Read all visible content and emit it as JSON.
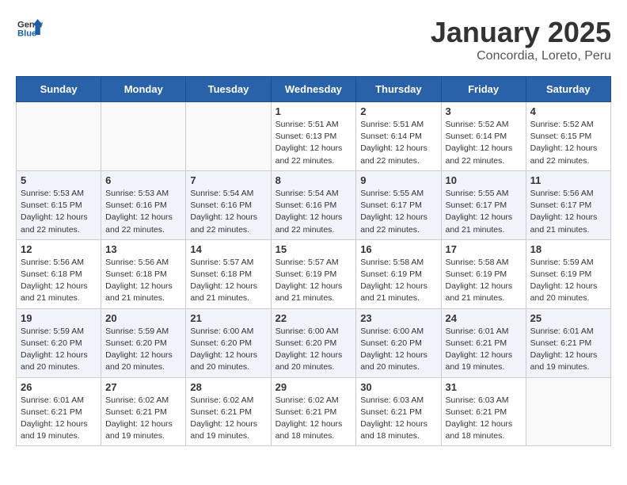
{
  "header": {
    "logo_general": "General",
    "logo_blue": "Blue",
    "month": "January 2025",
    "location": "Concordia, Loreto, Peru"
  },
  "weekdays": [
    "Sunday",
    "Monday",
    "Tuesday",
    "Wednesday",
    "Thursday",
    "Friday",
    "Saturday"
  ],
  "weeks": [
    [
      {
        "day": "",
        "info": ""
      },
      {
        "day": "",
        "info": ""
      },
      {
        "day": "",
        "info": ""
      },
      {
        "day": "1",
        "info": "Sunrise: 5:51 AM\nSunset: 6:13 PM\nDaylight: 12 hours\nand 22 minutes."
      },
      {
        "day": "2",
        "info": "Sunrise: 5:51 AM\nSunset: 6:14 PM\nDaylight: 12 hours\nand 22 minutes."
      },
      {
        "day": "3",
        "info": "Sunrise: 5:52 AM\nSunset: 6:14 PM\nDaylight: 12 hours\nand 22 minutes."
      },
      {
        "day": "4",
        "info": "Sunrise: 5:52 AM\nSunset: 6:15 PM\nDaylight: 12 hours\nand 22 minutes."
      }
    ],
    [
      {
        "day": "5",
        "info": "Sunrise: 5:53 AM\nSunset: 6:15 PM\nDaylight: 12 hours\nand 22 minutes."
      },
      {
        "day": "6",
        "info": "Sunrise: 5:53 AM\nSunset: 6:16 PM\nDaylight: 12 hours\nand 22 minutes."
      },
      {
        "day": "7",
        "info": "Sunrise: 5:54 AM\nSunset: 6:16 PM\nDaylight: 12 hours\nand 22 minutes."
      },
      {
        "day": "8",
        "info": "Sunrise: 5:54 AM\nSunset: 6:16 PM\nDaylight: 12 hours\nand 22 minutes."
      },
      {
        "day": "9",
        "info": "Sunrise: 5:55 AM\nSunset: 6:17 PM\nDaylight: 12 hours\nand 22 minutes."
      },
      {
        "day": "10",
        "info": "Sunrise: 5:55 AM\nSunset: 6:17 PM\nDaylight: 12 hours\nand 21 minutes."
      },
      {
        "day": "11",
        "info": "Sunrise: 5:56 AM\nSunset: 6:17 PM\nDaylight: 12 hours\nand 21 minutes."
      }
    ],
    [
      {
        "day": "12",
        "info": "Sunrise: 5:56 AM\nSunset: 6:18 PM\nDaylight: 12 hours\nand 21 minutes."
      },
      {
        "day": "13",
        "info": "Sunrise: 5:56 AM\nSunset: 6:18 PM\nDaylight: 12 hours\nand 21 minutes."
      },
      {
        "day": "14",
        "info": "Sunrise: 5:57 AM\nSunset: 6:18 PM\nDaylight: 12 hours\nand 21 minutes."
      },
      {
        "day": "15",
        "info": "Sunrise: 5:57 AM\nSunset: 6:19 PM\nDaylight: 12 hours\nand 21 minutes."
      },
      {
        "day": "16",
        "info": "Sunrise: 5:58 AM\nSunset: 6:19 PM\nDaylight: 12 hours\nand 21 minutes."
      },
      {
        "day": "17",
        "info": "Sunrise: 5:58 AM\nSunset: 6:19 PM\nDaylight: 12 hours\nand 21 minutes."
      },
      {
        "day": "18",
        "info": "Sunrise: 5:59 AM\nSunset: 6:19 PM\nDaylight: 12 hours\nand 20 minutes."
      }
    ],
    [
      {
        "day": "19",
        "info": "Sunrise: 5:59 AM\nSunset: 6:20 PM\nDaylight: 12 hours\nand 20 minutes."
      },
      {
        "day": "20",
        "info": "Sunrise: 5:59 AM\nSunset: 6:20 PM\nDaylight: 12 hours\nand 20 minutes."
      },
      {
        "day": "21",
        "info": "Sunrise: 6:00 AM\nSunset: 6:20 PM\nDaylight: 12 hours\nand 20 minutes."
      },
      {
        "day": "22",
        "info": "Sunrise: 6:00 AM\nSunset: 6:20 PM\nDaylight: 12 hours\nand 20 minutes."
      },
      {
        "day": "23",
        "info": "Sunrise: 6:00 AM\nSunset: 6:20 PM\nDaylight: 12 hours\nand 20 minutes."
      },
      {
        "day": "24",
        "info": "Sunrise: 6:01 AM\nSunset: 6:21 PM\nDaylight: 12 hours\nand 19 minutes."
      },
      {
        "day": "25",
        "info": "Sunrise: 6:01 AM\nSunset: 6:21 PM\nDaylight: 12 hours\nand 19 minutes."
      }
    ],
    [
      {
        "day": "26",
        "info": "Sunrise: 6:01 AM\nSunset: 6:21 PM\nDaylight: 12 hours\nand 19 minutes."
      },
      {
        "day": "27",
        "info": "Sunrise: 6:02 AM\nSunset: 6:21 PM\nDaylight: 12 hours\nand 19 minutes."
      },
      {
        "day": "28",
        "info": "Sunrise: 6:02 AM\nSunset: 6:21 PM\nDaylight: 12 hours\nand 19 minutes."
      },
      {
        "day": "29",
        "info": "Sunrise: 6:02 AM\nSunset: 6:21 PM\nDaylight: 12 hours\nand 18 minutes."
      },
      {
        "day": "30",
        "info": "Sunrise: 6:03 AM\nSunset: 6:21 PM\nDaylight: 12 hours\nand 18 minutes."
      },
      {
        "day": "31",
        "info": "Sunrise: 6:03 AM\nSunset: 6:21 PM\nDaylight: 12 hours\nand 18 minutes."
      },
      {
        "day": "",
        "info": ""
      }
    ]
  ]
}
